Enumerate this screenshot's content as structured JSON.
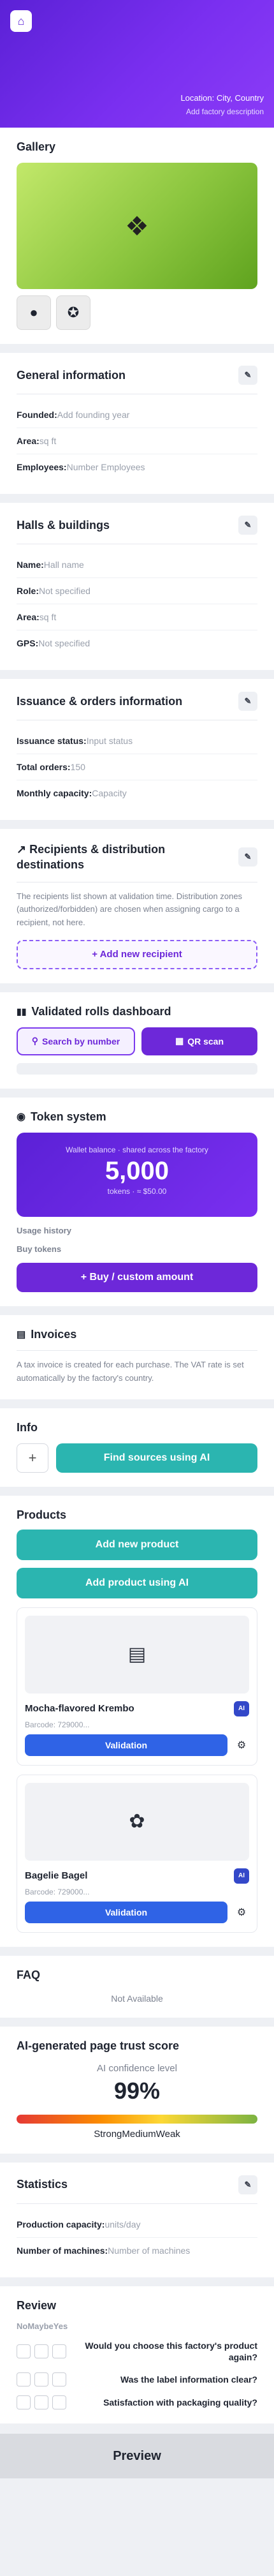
{
  "hero": {
    "location": "Location: City, Country",
    "description": "Add factory description"
  },
  "gallery": {
    "title": "Gallery"
  },
  "general": {
    "title": "General information",
    "founded_label": "Founded:",
    "founded_value": "Add founding year",
    "area_label": "Area:",
    "area_value": "sq ft",
    "employees_label": "Employees:",
    "employees_value": "Number Employees"
  },
  "halls": {
    "title": "Halls & buildings",
    "name_label": "Name:",
    "name_value": "Hall name",
    "role_label": "Role:",
    "role_value": "Not specified",
    "area_label": "Area:",
    "area_value": "sq ft",
    "gps_label": "GPS:",
    "gps_value": "Not specified"
  },
  "issuance": {
    "title": "Issuance & orders information",
    "status_label": "Issuance status:",
    "status_value": "Input status",
    "orders_label": "Total orders:",
    "orders_value": "150",
    "capacity_label": "Monthly capacity:",
    "capacity_value": "Capacity"
  },
  "recipients": {
    "title": "↗ Recipients & distribution destinations",
    "text": "The recipients list shown at validation time. Distribution zones (authorized/forbidden) are chosen when assigning cargo to a recipient, not here.",
    "add_button": "+ Add new recipient"
  },
  "rolls": {
    "title": "Validated rolls dashboard",
    "search_button": "Search by number",
    "qr_button": "QR scan"
  },
  "tokens": {
    "title": "Token system",
    "wallet_label": "Wallet balance · shared across the factory",
    "wallet_amount": "5,000",
    "wallet_sub": "tokens · ≈ $50.00",
    "usage_history": "Usage history",
    "buy_tokens": "Buy tokens",
    "buy_button": "+ Buy / custom amount"
  },
  "invoices": {
    "title": "Invoices",
    "text": "A tax invoice is created for each purchase. The VAT rate is set automatically by the factory's country."
  },
  "info": {
    "title": "Info",
    "find_button": "Find sources using AI"
  },
  "products": {
    "title": "Products",
    "add_button": "Add new product",
    "add_ai_button": "Add product using AI",
    "items": [
      {
        "name": "Mocha-flavored Krembo",
        "barcode": "Barcode: 729000...",
        "badge": "AI",
        "validation": "Validation"
      },
      {
        "name": "Bagelie Bagel",
        "barcode": "Barcode: 729000...",
        "badge": "AI",
        "validation": "Validation"
      }
    ]
  },
  "faq": {
    "title": "FAQ",
    "empty": "Not Available"
  },
  "trust": {
    "title": "AI-generated page trust score",
    "label": "AI confidence level",
    "percent": "99%",
    "legend": "StrongMediumWeak"
  },
  "statistics": {
    "title": "Statistics",
    "production_label": "Production capacity:",
    "production_value": "units/day",
    "machines_label": "Number of machines:",
    "machines_value": "Number of machines"
  },
  "review": {
    "title": "Review",
    "header": "NoMaybeYes",
    "questions": [
      "Would you choose this factory's product again?",
      "Was the label information clear?",
      "Satisfaction with packaging quality?"
    ]
  },
  "footer": {
    "preview": "Preview"
  },
  "colors": {
    "brand_purple": "#6d28d9",
    "teal": "#2bb5b0",
    "validation_blue": "#2f63e6",
    "gallery_green": "#8cc63f"
  },
  "icons": {
    "hero_back": "home-icon",
    "edit": "pencil-icon",
    "rolls": "bar-chart-icon",
    "tokens": "coin-icon",
    "invoices": "receipt-icon",
    "product1": "cake-icon",
    "product2": "bagel-icon",
    "settings": "gear-icon"
  }
}
